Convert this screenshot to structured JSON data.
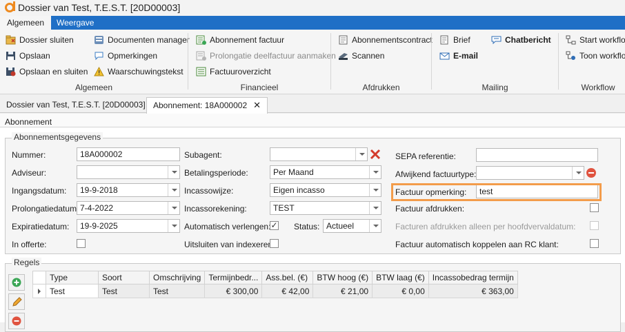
{
  "window": {
    "title": "Dossier van Test,  T.E.S.T. [20D00003]"
  },
  "ribbon_tabs": [
    "Algemeen",
    "Weergave"
  ],
  "ribbon": {
    "algemeen": {
      "label": "Algemeen",
      "dossier_sluiten": "Dossier sluiten",
      "opslaan": "Opslaan",
      "opslaan_en_sluiten": "Opslaan en sluiten",
      "documenten_manager": "Documenten manager",
      "opmerkingen": "Opmerkingen",
      "waarschuwingstekst": "Waarschuwingstekst"
    },
    "financieel": {
      "label": "Financieel",
      "abonnement_factuur": "Abonnement factuur",
      "prolongatie_deelfactuur": "Prolongatie deelfactuur aanmaken",
      "factuuroverzicht": "Factuuroverzicht"
    },
    "afdrukken": {
      "label": "Afdrukken",
      "abonnementscontract": "Abonnementscontract",
      "scannen": "Scannen"
    },
    "mailing": {
      "label": "Mailing",
      "brief": "Brief",
      "chatbericht": "Chatbericht",
      "email": "E-mail"
    },
    "workflow": {
      "label": "Workflow",
      "start_workflow": "Start workflo",
      "toon_workflow": "Toon workflo"
    }
  },
  "doc_tabs": [
    "Dossier van Test,  T.E.S.T. [20D00003]",
    "Abonnement: 18A000002"
  ],
  "panel": {
    "header": "Abonnement",
    "group_title": "Abonnementsgegevens",
    "fields": {
      "nummer": {
        "label": "Nummer:",
        "value": "18A000002"
      },
      "adviseur": {
        "label": "Adviseur:",
        "value": ""
      },
      "ingangsdatum": {
        "label": "Ingangsdatum:",
        "value": "19-9-2018"
      },
      "prolongatiedatum": {
        "label": "Prolongatiedatum:",
        "value": "7-4-2022"
      },
      "expiratiedatum": {
        "label": "Expiratiedatum:",
        "value": "19-9-2025"
      },
      "in_offerte": {
        "label": "In offerte:",
        "checked": false
      },
      "subagent": {
        "label": "Subagent:",
        "value": ""
      },
      "betalingsperiode": {
        "label": "Betalingsperiode:",
        "value": "Per Maand"
      },
      "incassowijze": {
        "label": "Incassowijze:",
        "value": "Eigen incasso"
      },
      "incassorekening": {
        "label": "Incassorekening:",
        "value": "TEST"
      },
      "automatisch_verlengen": {
        "label": "Automatisch verlengen:",
        "checked": true
      },
      "status": {
        "label": "Status:",
        "value": "Actueel"
      },
      "uitsluiten_indexeren": {
        "label": "Uitsluiten van indexeren:",
        "checked": false
      },
      "sepa_referentie": {
        "label": "SEPA referentie:",
        "value": ""
      },
      "afwijkend_factuurtype": {
        "label": "Afwijkend factuurtype:",
        "value": ""
      },
      "factuur_opmerking": {
        "label": "Factuur opmerking:",
        "value": "test"
      },
      "factuur_afdrukken": {
        "label": "Factuur afdrukken:",
        "checked": false
      },
      "facturen_afdrukken_hoofdvervaldatum": {
        "label": "Facturen afdrukken alleen per hoofdvervaldatum:",
        "checked": false
      },
      "factuur_koppelen_rc": {
        "label": "Factuur automatisch koppelen aan RC klant:",
        "checked": false
      }
    },
    "regels": {
      "title": "Regels",
      "columns": [
        "Type",
        "Soort",
        "Omschrijving",
        "Termijnbedr...",
        "Ass.bel. (€)",
        "BTW hoog (€)",
        "BTW laag (€)",
        "Incassobedrag termijn"
      ],
      "rows": [
        [
          "Test",
          "Test",
          "Test",
          "€ 300,00",
          "€ 42,00",
          "€ 21,00",
          "€ 0,00",
          "€ 363,00"
        ]
      ]
    }
  },
  "colors": {
    "ribbon_tab_bar": "#1f6fc6",
    "highlight": "#f39c4a",
    "app_accent": "#ee8a1f"
  }
}
